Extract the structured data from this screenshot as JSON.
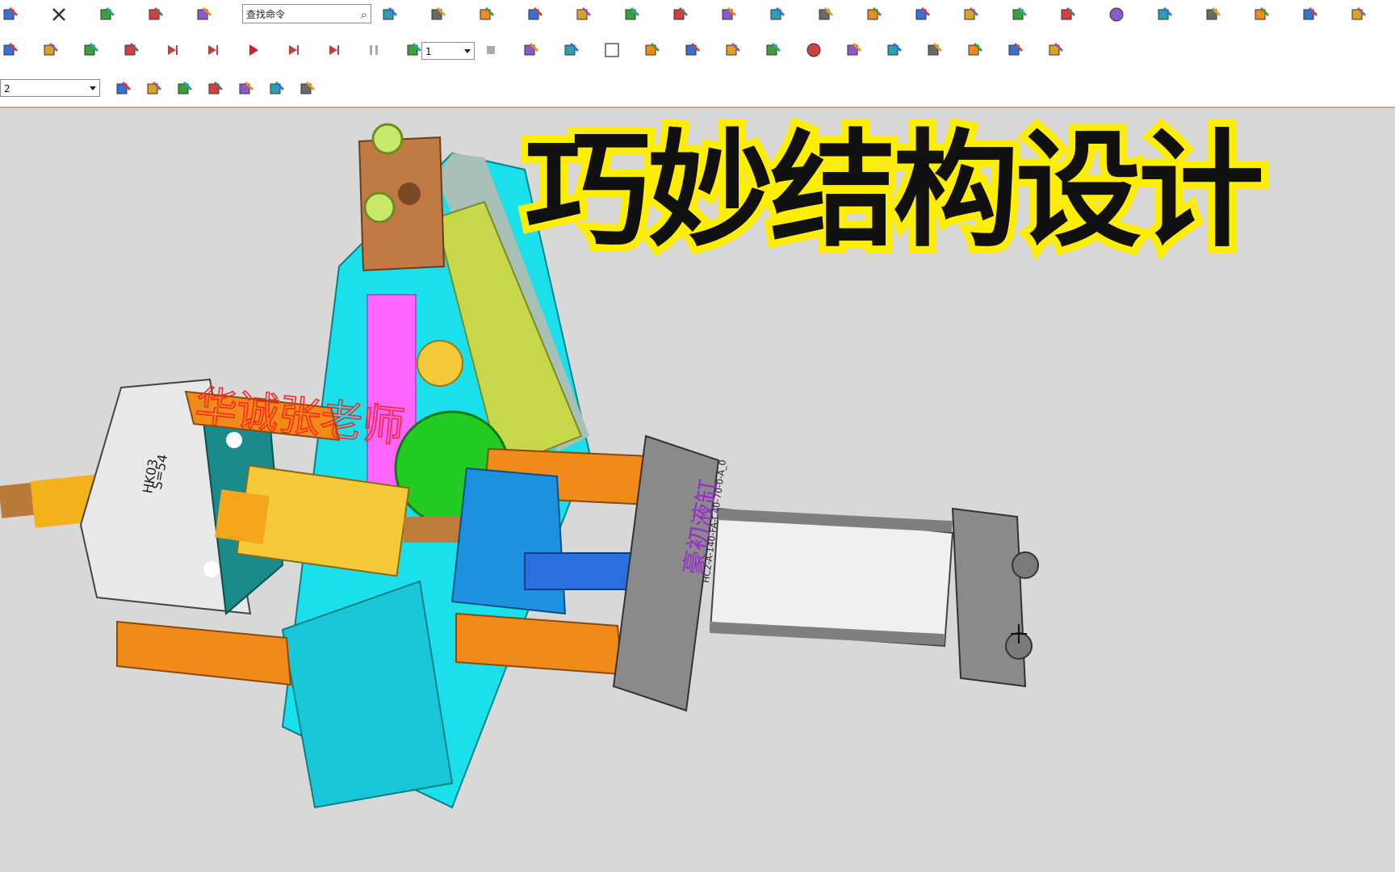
{
  "window": {
    "search_placeholder": "查找命令",
    "layer_value": "1",
    "filter_value": "2"
  },
  "toolbar_row1": [
    "new-icon",
    "close-icon",
    "undo-icon",
    "paste-icon",
    "copy-icon",
    "properties-icon",
    "sketch-icon",
    "datum-icon",
    "formula-icon",
    "pencil-icon",
    "dimension-icon",
    "settings-icon",
    "spring-icon",
    "curve-icon",
    "line-icon",
    "point-icon",
    "hole-icon",
    "ruler-icon",
    "assembly-icon",
    "box-icon",
    "circle-icon",
    "measure-icon",
    "check-icon",
    "report-icon",
    "note-icon",
    "analysis-icon"
  ],
  "toolbar_row2": [
    "snap-icon",
    "route-icon",
    "move-icon",
    "surface-icon",
    "first-frame-icon",
    "prev-frame-icon",
    "play-icon",
    "next-frame-icon",
    "last-frame-icon",
    "pause-icon",
    "record-icon",
    "stop-icon",
    "filter-icon",
    "flag-icon",
    "square-icon",
    "grid-icon",
    "rotate-icon",
    "spring-feature-icon",
    "pen-icon",
    "sphere-icon",
    "cylinder-icon",
    "plus-point-icon",
    "vector-icon",
    "arc-icon",
    "axis-icon",
    "triad-icon"
  ],
  "toolbar_row3": [
    "layer-icon",
    "select-icon",
    "link-icon",
    "filter-drop-icon",
    "box-select-icon",
    "shade-icon",
    "cube-icon"
  ],
  "overlay": {
    "title": "巧妙结构设计",
    "watermark": "华诚张老师"
  },
  "model_labels": {
    "spring_box": "HK03\nS=54",
    "cylinder_code": "HC2-A-140-FA-C40-70-0-A_0",
    "cylinder_brand": "豪初液缸"
  },
  "colors": {
    "title_fill": "#111111",
    "title_stroke": "#ffee00",
    "plate_cyan": "#19e0ea",
    "gear_pink": "#ff66ff",
    "gear_green": "#22cc22",
    "gear_yellow": "#f6c93a",
    "bracket_orange": "#f08b1a",
    "block_blue": "#1e90e0",
    "cylinder_gray": "#7f7f7f",
    "plate_olive": "#c6d84a",
    "top_block": "#c27a44"
  }
}
